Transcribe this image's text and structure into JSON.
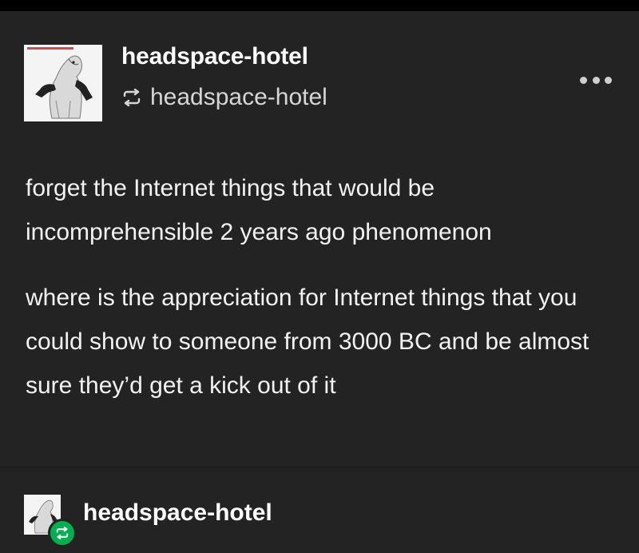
{
  "post": {
    "blog_name": "headspace-hotel",
    "reblogged_from": "headspace-hotel",
    "reblog_icon": "reblog-icon",
    "menu_icon": "more-options-icon",
    "paragraphs": [
      "forget the Internet things that would be incomprehensible 2 years ago phenomenon",
      "where is the appreciation for Internet things that you could show to someone from 3000 BC and be almost sure they’d get a kick out of it"
    ]
  },
  "footer": {
    "blog_name": "headspace-hotel",
    "badge_icon": "reblog-badge-icon"
  },
  "colors": {
    "background": "#232323",
    "text": "#f2f2f2",
    "reblog_badge": "#00b04f"
  }
}
